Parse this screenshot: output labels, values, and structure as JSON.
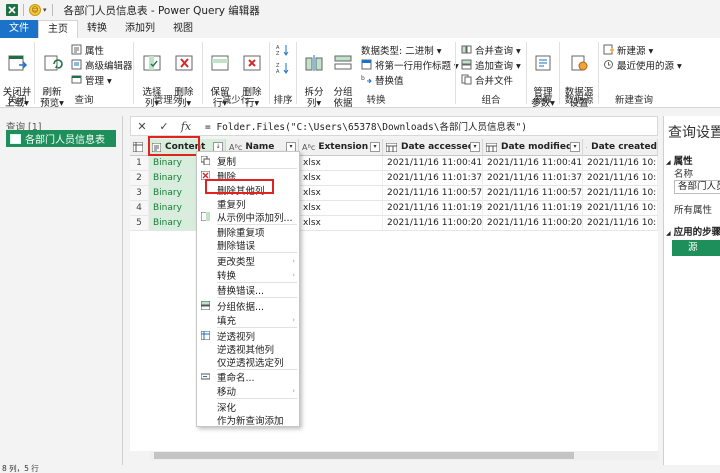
{
  "window": {
    "title": "各部门人员信息表 - Power Query 编辑器"
  },
  "tabs": [
    {
      "label": "文件"
    },
    {
      "label": "主页"
    },
    {
      "label": "转换"
    },
    {
      "label": "添加列"
    },
    {
      "label": "视图"
    }
  ],
  "ribbon": {
    "close_group": {
      "label": "关闭",
      "close_apply": "关闭并\n上载▾"
    },
    "query_group": {
      "label": "查询",
      "refresh": "刷新\n预览▾",
      "properties": "属性",
      "advanced_editor": "高级编辑器",
      "manage": "管理 ▾"
    },
    "manage_cols_group": {
      "label": "管理列",
      "choose_cols": "选择\n列▾",
      "remove_cols": "删除\n列▾"
    },
    "reduce_rows_group": {
      "label": "减少行",
      "keep_rows": "保留\n行▾",
      "remove_rows": "删除\n行▾"
    },
    "sort_group": {
      "label": "排序"
    },
    "transform_group": {
      "label": "转换",
      "split_col": "拆分\n列▾",
      "group_by": "分组\n依据",
      "data_type": "数据类型: 二进制 ▾",
      "first_row_header": "将第一行用作标题 ▾",
      "replace_values": "替换值"
    },
    "combine_group": {
      "label": "组合",
      "merge_queries": "合并查询 ▾",
      "append_queries": "追加查询 ▾",
      "combine_files": "合并文件"
    },
    "params_group": {
      "label": "参数",
      "manage_params": "管理\n参数▾"
    },
    "datasource_group": {
      "label": "数据源",
      "ds_settings": "数据源\n设置"
    },
    "newquery_group": {
      "label": "新建查询",
      "new_source": "新建源 ▾",
      "recent_sources": "最近使用的源 ▾"
    }
  },
  "query_pane": {
    "header": "查询 [1]",
    "item": "各部门人员信息表"
  },
  "formula_bar": {
    "cancel": "✕",
    "confirm": "✓",
    "fx": "fx",
    "formula": "= Folder.Files(\"C:\\Users\\65378\\Downloads\\各部门人员信息表\")"
  },
  "grid": {
    "columns": [
      {
        "name": "Content",
        "type": ""
      },
      {
        "name": "Name",
        "type": "Aᴮᴄ"
      },
      {
        "name": "Extension",
        "type": "Aᴮᴄ"
      },
      {
        "name": "Date accessed",
        "type": ""
      },
      {
        "name": "Date modified",
        "type": ""
      },
      {
        "name": "Date created",
        "type": ""
      }
    ],
    "rows": [
      {
        "num": "1",
        "content": "Binary",
        "ext": "xlsx",
        "accessed": "2021/11/16 11:00:41",
        "modified": "2021/11/16 11:00:41",
        "created": "2021/11/16 10:"
      },
      {
        "num": "2",
        "content": "Binary",
        "ext": "xlsx",
        "accessed": "2021/11/16 11:01:37",
        "modified": "2021/11/16 11:01:37",
        "created": "2021/11/16 10:"
      },
      {
        "num": "3",
        "content": "Binary",
        "ext": "xlsx",
        "accessed": "2021/11/16 11:00:57",
        "modified": "2021/11/16 11:00:57",
        "created": "2021/11/16 10:"
      },
      {
        "num": "4",
        "content": "Binary",
        "ext": "xlsx",
        "accessed": "2021/11/16 11:01:19",
        "modified": "2021/11/16 11:01:19",
        "created": "2021/11/16 10:"
      },
      {
        "num": "5",
        "content": "Binary",
        "ext": "xlsx",
        "accessed": "2021/11/16 11:00:20",
        "modified": "2021/11/16 11:00:20",
        "created": "2021/11/16 10:"
      }
    ]
  },
  "context_menu": {
    "items": [
      "复制",
      "删除",
      "删除其他列",
      "重复列",
      "从示例中添加列...",
      "删除重复项",
      "删除错误",
      "更改类型",
      "转换",
      "替换错误...",
      "分组依据...",
      "填充",
      "逆透视列",
      "逆透视其他列",
      "仅逆透视选定列",
      "重命名...",
      "移动",
      "深化",
      "作为新查询添加"
    ]
  },
  "settings_pane": {
    "title": "查询设置",
    "properties": "属性",
    "name_label": "名称",
    "name_value": "各部门人员信息表",
    "all_properties": "所有属性",
    "applied_steps": "应用的步骤",
    "step": "源"
  },
  "status": {
    "text": "8 列，5 行"
  },
  "colors": {
    "accent": "#1a73c8",
    "green": "#1e8e5a",
    "highlight": "#e0231f"
  }
}
